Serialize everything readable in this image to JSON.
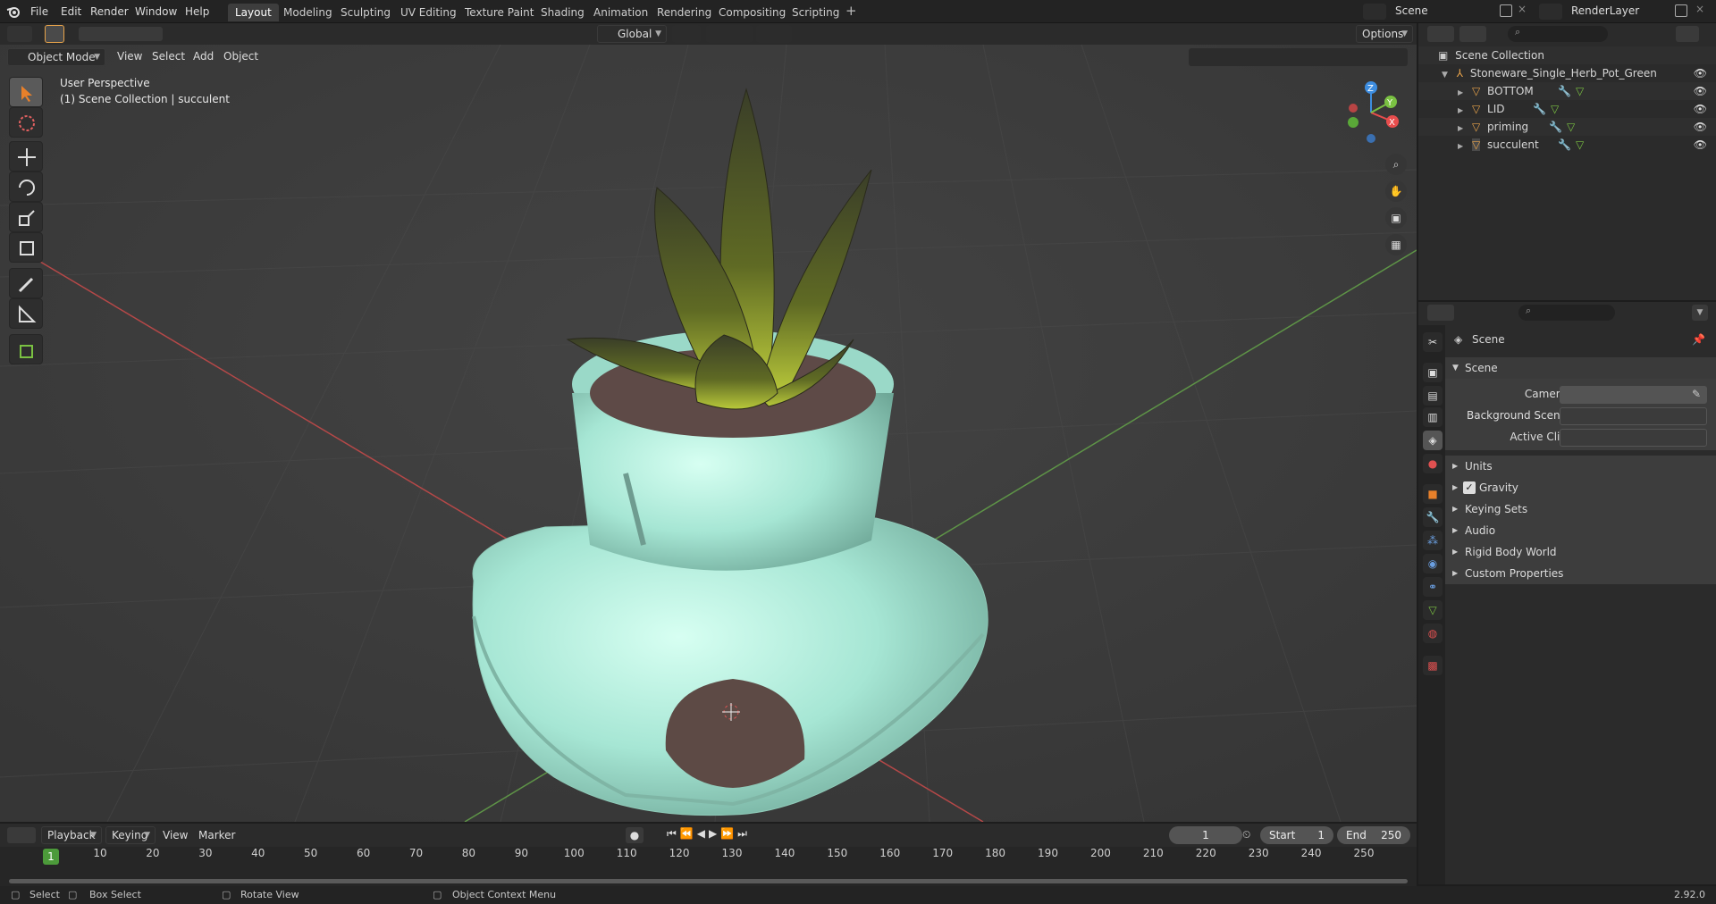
{
  "topbar": {
    "menus": [
      "File",
      "Edit",
      "Render",
      "Window",
      "Help"
    ],
    "workspaces": [
      "Layout",
      "Modeling",
      "Sculpting",
      "UV Editing",
      "Texture Paint",
      "Shading",
      "Animation",
      "Rendering",
      "Compositing",
      "Scripting"
    ],
    "active_workspace": "Layout",
    "scene_name": "Scene",
    "view_layer": "RenderLayer"
  },
  "viewport_header": {
    "mode": "Object Mode",
    "menus": [
      "View",
      "Select",
      "Add",
      "Object"
    ],
    "orientation": "Global",
    "options_label": "Options"
  },
  "viewport": {
    "view_name": "User Perspective",
    "context": "(1) Scene Collection | succulent",
    "gizmo_axes": {
      "x": "X",
      "y": "Y",
      "z": "Z"
    }
  },
  "outliner": {
    "root": "Scene Collection",
    "collection": "Stoneware_Single_Herb_Pot_Green",
    "objects": [
      "BOTTOM",
      "LID",
      "priming",
      "succulent"
    ]
  },
  "properties": {
    "title": "Scene",
    "panel": "Scene",
    "fields": [
      {
        "label": "Camera",
        "value": ""
      },
      {
        "label": "Background Scene",
        "value": ""
      },
      {
        "label": "Active Clip",
        "value": ""
      }
    ],
    "subpanels": [
      "Units",
      "Gravity",
      "Keying Sets",
      "Audio",
      "Rigid Body World",
      "Custom Properties"
    ],
    "gravity_checked": true
  },
  "timeline": {
    "menus": [
      "Playback",
      "Keying",
      "View",
      "Marker"
    ],
    "current_frame": "1",
    "start_label": "Start",
    "start": "1",
    "end_label": "End",
    "end": "250",
    "ticks": [
      "10",
      "20",
      "30",
      "40",
      "50",
      "60",
      "70",
      "80",
      "90",
      "100",
      "110",
      "120",
      "130",
      "140",
      "150",
      "160",
      "170",
      "180",
      "190",
      "200",
      "210",
      "220",
      "230",
      "240",
      "250"
    ],
    "playhead": "1"
  },
  "statusbar": {
    "select": "Select",
    "box_select": "Box Select",
    "rotate_view": "Rotate View",
    "context_menu": "Object Context Menu",
    "version": "2.92.0"
  },
  "colors": {
    "accent": "#e8802a",
    "active_tool": "#5a5a5a",
    "object_icon": "#e8a34a",
    "pot": "#a8e8d6",
    "playhead": "#4c9a3a",
    "x_axis": "#e84d4d",
    "y_axis": "#7ac142",
    "z_axis": "#3d8de0"
  }
}
